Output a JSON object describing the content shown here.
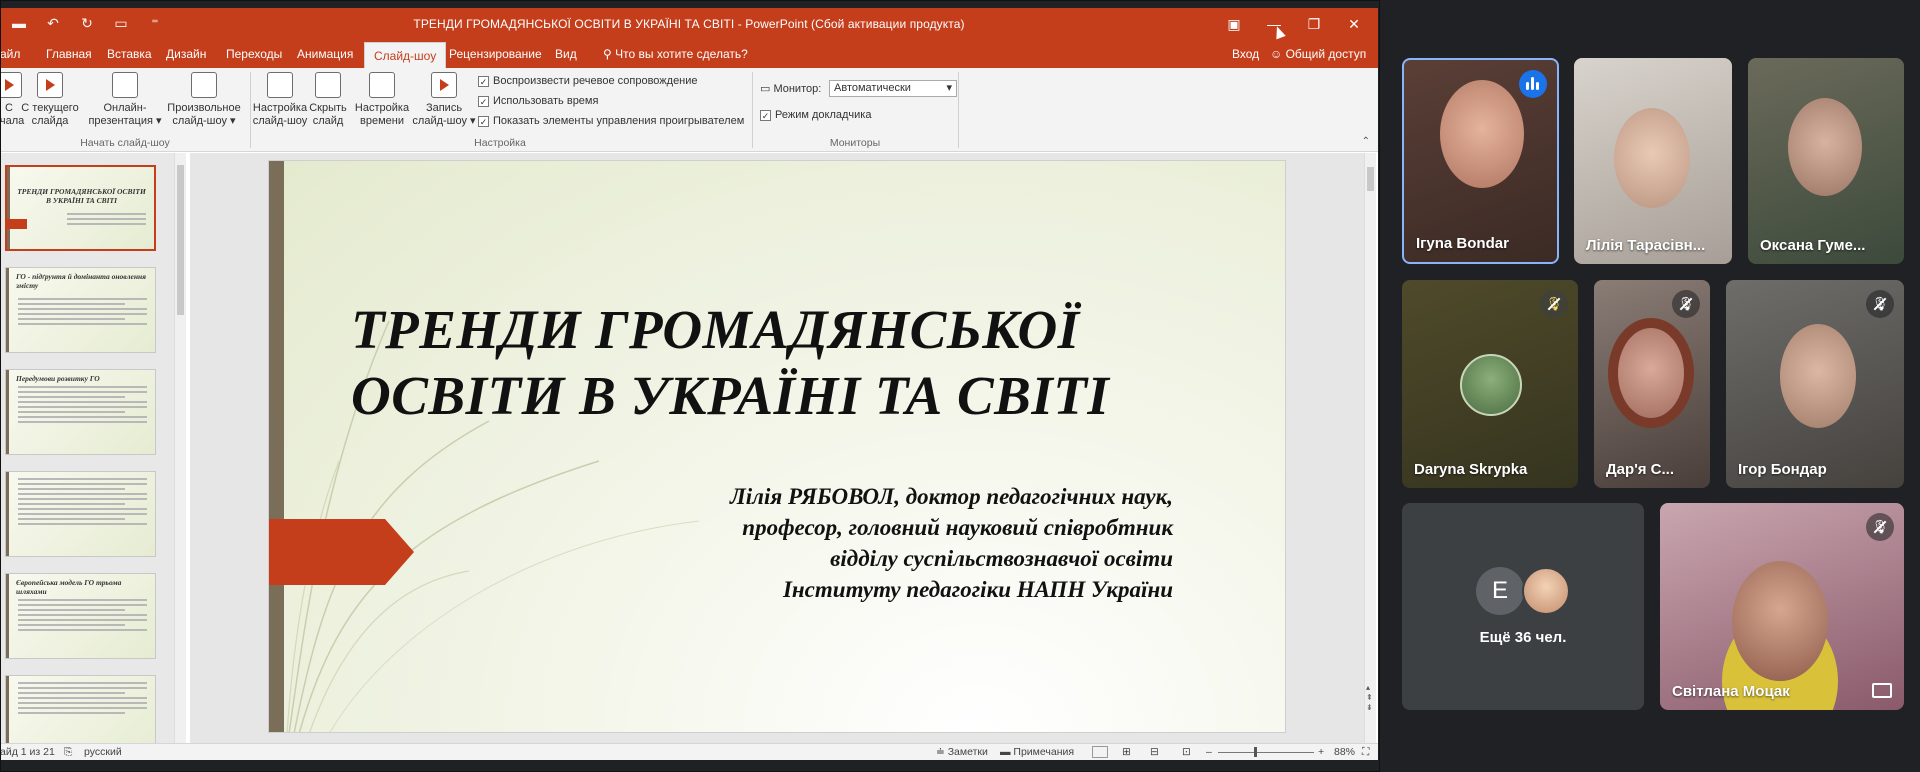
{
  "powerpoint": {
    "window_title": "ТРЕНДИ ГРОМАДЯНСЬКОЇ ОСВІТИ В УКРАЇНІ ТА СВІТІ - PowerPoint (Сбой активации продукта)",
    "tabs": [
      "айл",
      "Главная",
      "Вставка",
      "Дизайн",
      "Переходы",
      "Анимация",
      "Слайд-шоу",
      "Рецензирование",
      "Вид"
    ],
    "active_tab": "Слайд-шоу",
    "tell_me": "Что вы хотите сделать?",
    "signin": "Вход",
    "share": "Общий доступ",
    "ribbon": {
      "from_start": [
        "С",
        "ачала"
      ],
      "from_current": [
        "С текущего",
        "слайда"
      ],
      "online": [
        "Онлайн-",
        "презентация"
      ],
      "custom": [
        "Произвольное",
        "слайд-шоу"
      ],
      "group1_label": "Начать слайд-шоу",
      "setup": [
        "Настройка",
        "слайд-шоу"
      ],
      "hide": [
        "Скрыть",
        "слайд"
      ],
      "rehearse": [
        "Настройка",
        "времени"
      ],
      "record": [
        "Запись",
        "слайд-шоу"
      ],
      "check_narration": "Воспроизвести речевое сопровождение",
      "check_timings": "Использовать время",
      "check_media": "Показать элементы управления проигрывателем",
      "group2_label": "Настройка",
      "monitor_label": "Монитор:",
      "monitor_value": "Автоматически",
      "presenter_view": "Режим докладчика",
      "group3_label": "Мониторы"
    },
    "thumbnails": [
      {
        "title": "ТРЕНДИ ГРОМАДЯНСЬКОЇ ОСВІТИ В УКРАЇНІ ТА СВІТІ"
      },
      {
        "title": "ГО - підґрунтя й домінанта оновлення змісту"
      },
      {
        "title": "Передумови розвитку ГО"
      },
      {
        "title": ""
      },
      {
        "title": "Європейська модель ГО трьома шляхами"
      },
      {
        "title": ""
      }
    ],
    "slide": {
      "title_line1": "ТРЕНДИ ГРОМАДЯНСЬКОЇ",
      "title_line2": "ОСВІТИ В УКРАЇНІ ТА СВІТІ",
      "author_line1": "Лілія РЯБОВОЛ, доктор педагогічних наук,",
      "author_line2": "професор, головний науковий співробтник",
      "author_line3": "відділу суспільствознавчої освіти",
      "author_line4": "Інституту педагогіки НАПН України"
    },
    "status": {
      "slide_count": "айд 1 из 21",
      "language": "русский",
      "notes": "Заметки",
      "comments": "Примечания",
      "zoom": "88%"
    },
    "colors": {
      "accent": "#c43e1c",
      "bar": "#7a6e58"
    }
  },
  "meet": {
    "participants": [
      {
        "name": "Iгуna Bondar",
        "state": "speaking"
      },
      {
        "name": "Лілія Тарасівн...",
        "state": "none"
      },
      {
        "name": "Оксана Гуме...",
        "state": "none"
      },
      {
        "name": "Daryna Skrypka",
        "state": "muted"
      },
      {
        "name": "Дар'я С...",
        "state": "muted"
      },
      {
        "name": "Ігор Бондар",
        "state": "muted"
      },
      {
        "name": "Світлана Моцак",
        "state": "muted"
      }
    ],
    "more": {
      "avatar_letter": "E",
      "label": "Ещё 36 чел."
    },
    "colors": {
      "background": "#202124",
      "tile": "#3c4043",
      "speaking": "#1a73e8"
    }
  }
}
